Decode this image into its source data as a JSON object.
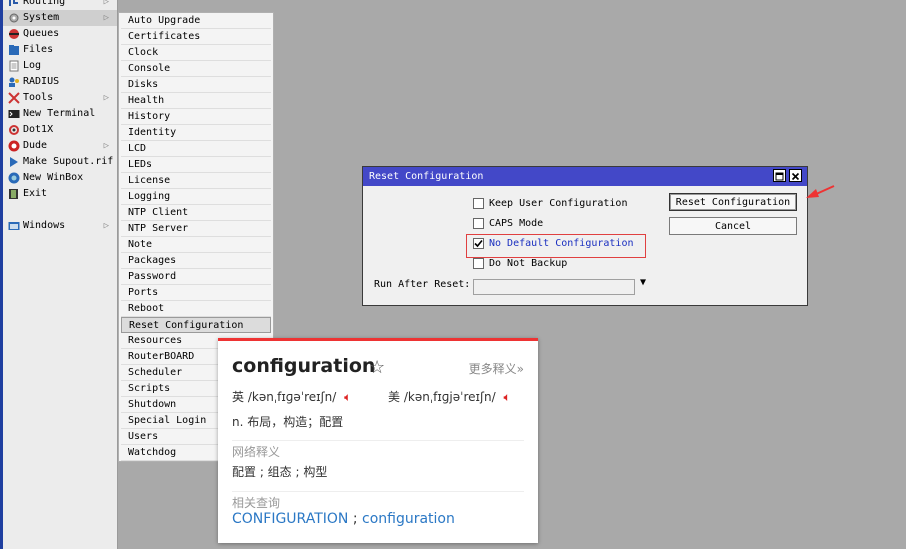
{
  "left_menu": {
    "items": [
      {
        "label": "Routing",
        "icon": "routing-icon",
        "arrow": true
      },
      {
        "label": "System",
        "icon": "system-icon",
        "arrow": true,
        "selected": true
      },
      {
        "label": "Queues",
        "icon": "queues-icon"
      },
      {
        "label": "Files",
        "icon": "files-icon"
      },
      {
        "label": "Log",
        "icon": "log-icon"
      },
      {
        "label": "RADIUS",
        "icon": "radius-icon"
      },
      {
        "label": "Tools",
        "icon": "tools-icon",
        "arrow": true
      },
      {
        "label": "New Terminal",
        "icon": "terminal-icon"
      },
      {
        "label": "Dot1X",
        "icon": "dot1x-icon"
      },
      {
        "label": "Dude",
        "icon": "dude-icon",
        "arrow": true
      },
      {
        "label": "Make Supout.rif",
        "icon": "supout-icon"
      },
      {
        "label": "New WinBox",
        "icon": "winbox-icon"
      },
      {
        "label": "Exit",
        "icon": "exit-icon"
      },
      {
        "label": "Windows",
        "icon": "windows-icon",
        "arrow": true
      }
    ]
  },
  "system_menu": {
    "items": [
      "Auto Upgrade",
      "Certificates",
      "Clock",
      "Console",
      "Disks",
      "Health",
      "History",
      "Identity",
      "LCD",
      "LEDs",
      "License",
      "Logging",
      "NTP Client",
      "NTP Server",
      "Note",
      "Packages",
      "Password",
      "Ports",
      "Reboot",
      "Reset Configuration",
      "Resources",
      "RouterBOARD",
      "Scheduler",
      "Scripts",
      "Shutdown",
      "Special Login",
      "Users",
      "Watchdog"
    ],
    "selected": "Reset Configuration"
  },
  "dialog": {
    "title": "Reset Configuration",
    "checkboxes": [
      {
        "label": "Keep User Configuration",
        "checked": false
      },
      {
        "label": "CAPS Mode",
        "checked": false
      },
      {
        "label": "No Default Configuration",
        "checked": true
      },
      {
        "label": "Do Not Backup",
        "checked": false
      }
    ],
    "reset_button": "Reset Configuration",
    "cancel_button": "Cancel",
    "run_after_reset_label": "Run After Reset:",
    "run_after_reset_value": ""
  },
  "dictionary_popup": {
    "word": "configuration",
    "more_label": "更多释义»",
    "uk_label": "英",
    "uk_phonetic": "/kənˌfɪɡəˈreɪʃn/",
    "us_label": "美",
    "us_phonetic": "/kənˌfɪɡjəˈreɪʃn/",
    "definition": "n. 布局，构造；配置",
    "web_section": "网络释义",
    "web_meaning": "配置 ; 组态 ; 构型",
    "related_section": "相关查询",
    "related_1": "CONFIGURATION",
    "related_sep": " ; ",
    "related_2": "configuration",
    "accent_color": "#e33333",
    "link_color": "#2b78c5"
  },
  "colors": {
    "titlebar": "#4348c8",
    "highlight_box": "#e04040",
    "desktop": "#a9a9a9"
  }
}
